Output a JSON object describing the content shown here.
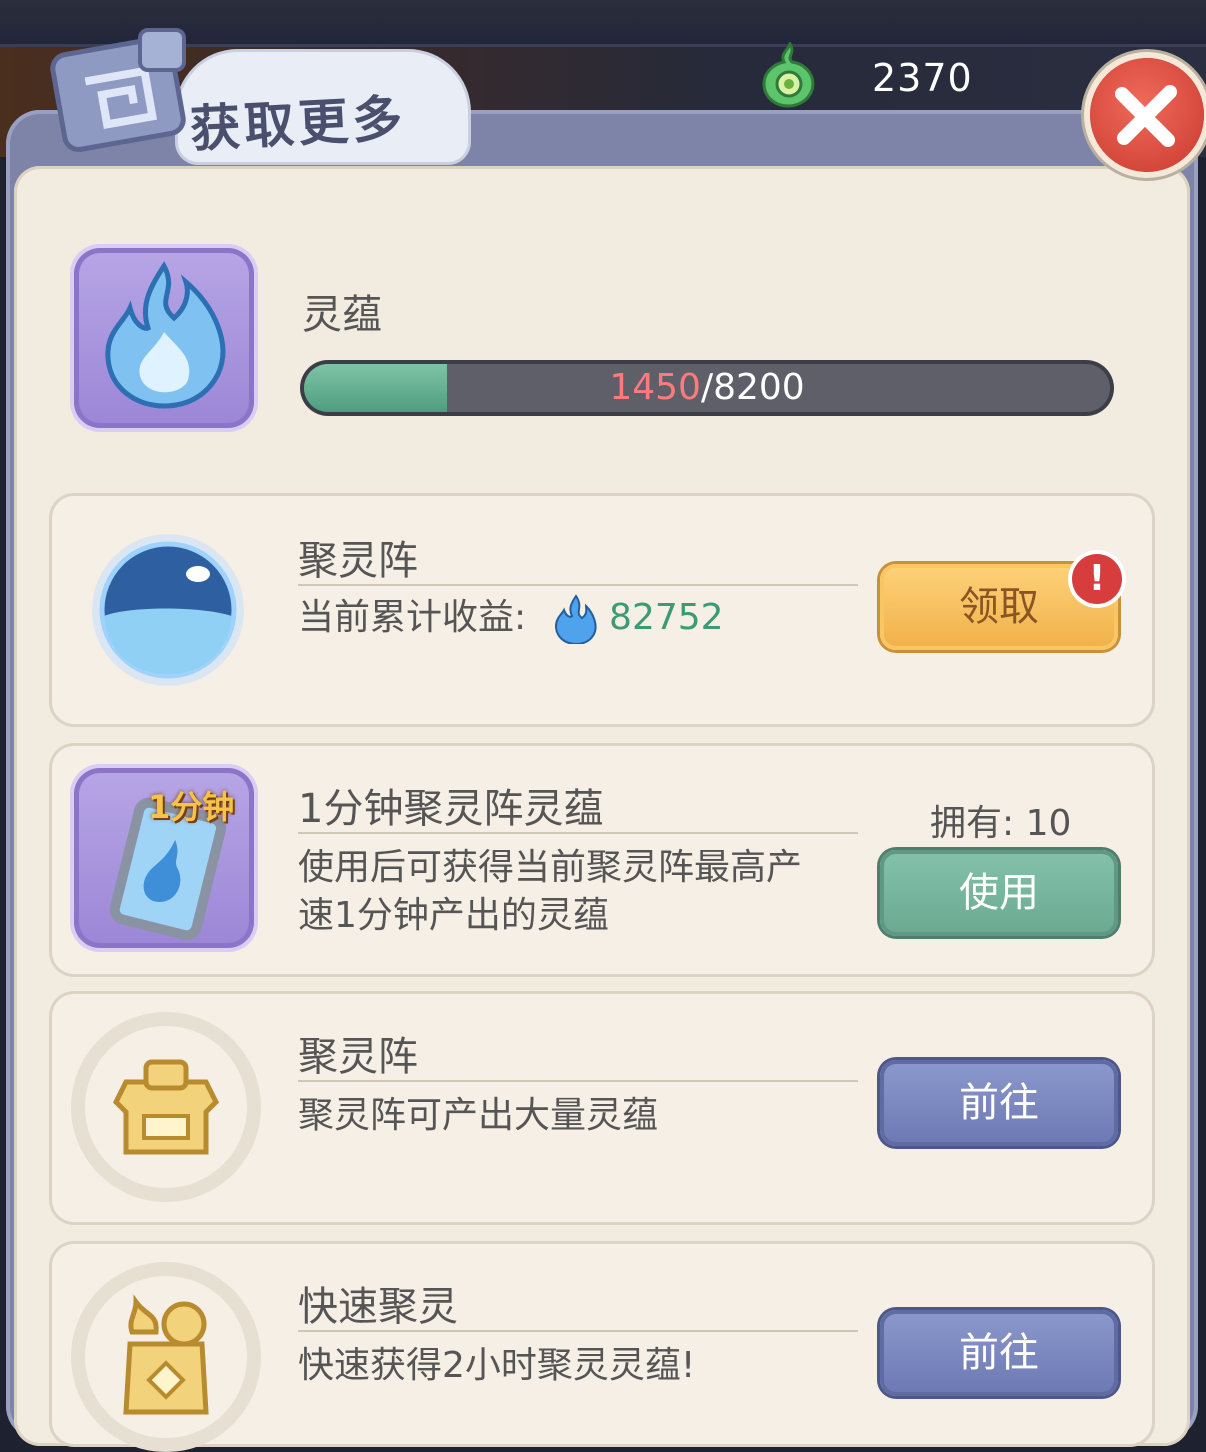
{
  "header": {
    "currency_value": "2370",
    "title": "获取更多"
  },
  "resource": {
    "name": "灵蕴",
    "current": "1450",
    "separator": "/8200",
    "progress_fraction": 0.177
  },
  "cards": [
    {
      "title": "聚灵阵",
      "income_label": "当前累计收益:",
      "income_value": "82752",
      "button": "领取",
      "alert": "!"
    },
    {
      "title": "1分钟聚灵阵灵蕴",
      "badge": "1分钟",
      "desc_line1": "使用后可获得当前聚灵阵最高产",
      "desc_line2": "速1分钟产出的灵蕴",
      "owned": "拥有: 10",
      "button": "使用"
    },
    {
      "title": "聚灵阵",
      "desc_line1": "聚灵阵可产出大量灵蕴",
      "button": "前往"
    },
    {
      "title": "快速聚灵",
      "desc_line1": "快速获得2小时聚灵灵蕴!",
      "button": "前往"
    }
  ],
  "colors": {
    "gold_button": "#f0b048",
    "green_button": "#6aa890",
    "blue_button": "#6c78b2",
    "progress_fill": "#4f9d80",
    "alert_red": "#d83d3d"
  }
}
